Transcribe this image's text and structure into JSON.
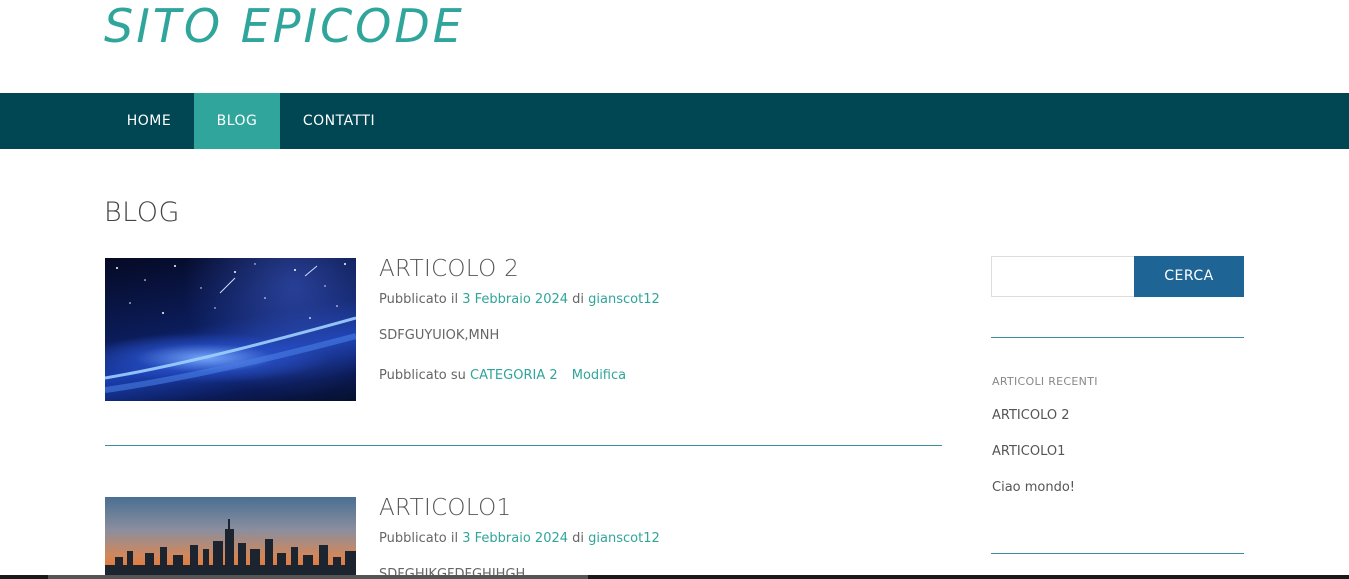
{
  "site": {
    "title": "SITO EPICODE"
  },
  "nav": {
    "items": [
      {
        "label": "HOME"
      },
      {
        "label": "BLOG"
      },
      {
        "label": "CONTATTI"
      }
    ]
  },
  "page": {
    "title": "BLOG"
  },
  "posts": [
    {
      "title": "ARTICOLO 2",
      "published_prefix": "Pubblicato il",
      "date": "3 Febbraio 2024",
      "by": "di",
      "author": "gianscot12",
      "excerpt": "SDFGUYUIOK,MNH",
      "category_prefix": "Pubblicato su",
      "category": "CATEGORIA 2",
      "edit": "Modifica"
    },
    {
      "title": "ARTICOLO1",
      "published_prefix": "Pubblicato il",
      "date": "3 Febbraio 2024",
      "by": "di",
      "author": "gianscot12",
      "excerpt": "SDFGHJKGFDFGHJHGH"
    }
  ],
  "sidebar": {
    "search": {
      "button": "CERCA",
      "placeholder": ""
    },
    "recent": {
      "title": "ARTICOLI RECENTI",
      "items": [
        "ARTICOLO 2",
        "ARTICOLO1",
        "Ciao mondo!"
      ]
    }
  },
  "colors": {
    "accent": "#30a59b",
    "nav_bg": "#004653",
    "button": "#1e6494"
  }
}
